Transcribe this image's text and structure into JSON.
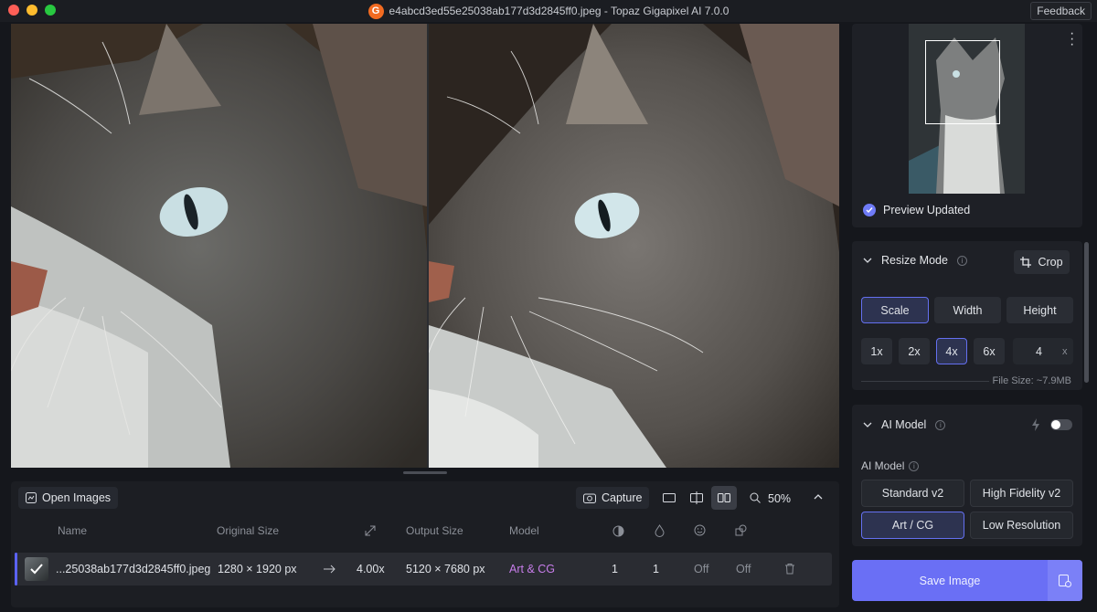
{
  "window": {
    "title": "e4abcd3ed55e25038ab177d3d2845ff0.jpeg - Topaz Gigapixel AI 7.0.0",
    "logo_letter": "G",
    "feedback_label": "Feedback"
  },
  "toolbar": {
    "open_images_label": "Open Images",
    "capture_label": "Capture",
    "zoom_level": "50%"
  },
  "table": {
    "headers": {
      "name": "Name",
      "original_size": "Original Size",
      "output_size": "Output Size",
      "model": "Model"
    },
    "rows": [
      {
        "name": "...25038ab177d3d2845ff0.jpeg",
        "original_size": "1280 × 1920 px",
        "scale": "4.00x",
        "output_size": "5120 × 7680 px",
        "model": "Art & CG",
        "val1": "1",
        "val2": "1",
        "val3": "Off",
        "val4": "Off"
      }
    ]
  },
  "preview": {
    "status": "Preview Updated"
  },
  "resize": {
    "title": "Resize Mode",
    "crop_label": "Crop",
    "modes": [
      "Scale",
      "Width",
      "Height"
    ],
    "active_mode": "Scale",
    "multipliers": [
      "1x",
      "2x",
      "4x",
      "6x"
    ],
    "active_multiplier": "4x",
    "custom_value": "4",
    "custom_unit": "x",
    "file_size": "File Size: ~7.9MB"
  },
  "ai_model": {
    "title": "AI Model",
    "label": "AI Model",
    "models": [
      "Standard v2",
      "High Fidelity v2",
      "Art / CG",
      "Low Resolution"
    ],
    "active_model": "Art / CG"
  },
  "actions": {
    "save_label": "Save Image"
  },
  "colors": {
    "accent": "#6a6ff5",
    "model_text": "#c77dea",
    "logo": "#f26b21"
  }
}
